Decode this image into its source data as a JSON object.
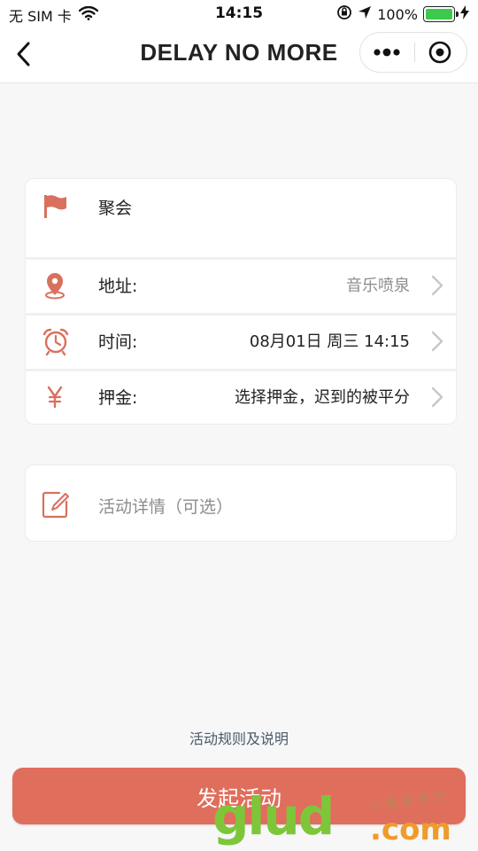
{
  "status_bar": {
    "carrier": "无 SIM 卡",
    "time": "14:15",
    "battery_percent": "100%"
  },
  "nav": {
    "title": "DELAY NO MORE"
  },
  "form": {
    "activity_name": "聚会",
    "rows": [
      {
        "label": "地址:",
        "value": "音乐喷泉",
        "icon": "location-pin-icon"
      },
      {
        "label": "时间:",
        "value": "08月01日 周三 14:15",
        "icon": "alarm-clock-icon"
      },
      {
        "label": "押金:",
        "value": "选择押金，迟到的被平分",
        "icon": "yen-icon"
      }
    ],
    "details_placeholder": "活动详情（可选）"
  },
  "footer": {
    "rules_link": "活动规则及说明",
    "submit_label": "发起活动"
  },
  "watermark": {
    "main": "glud",
    "com": ".com",
    "small": "小程序商店"
  },
  "colors": {
    "accent": "#e06e5c",
    "battery": "#3dc94b"
  }
}
